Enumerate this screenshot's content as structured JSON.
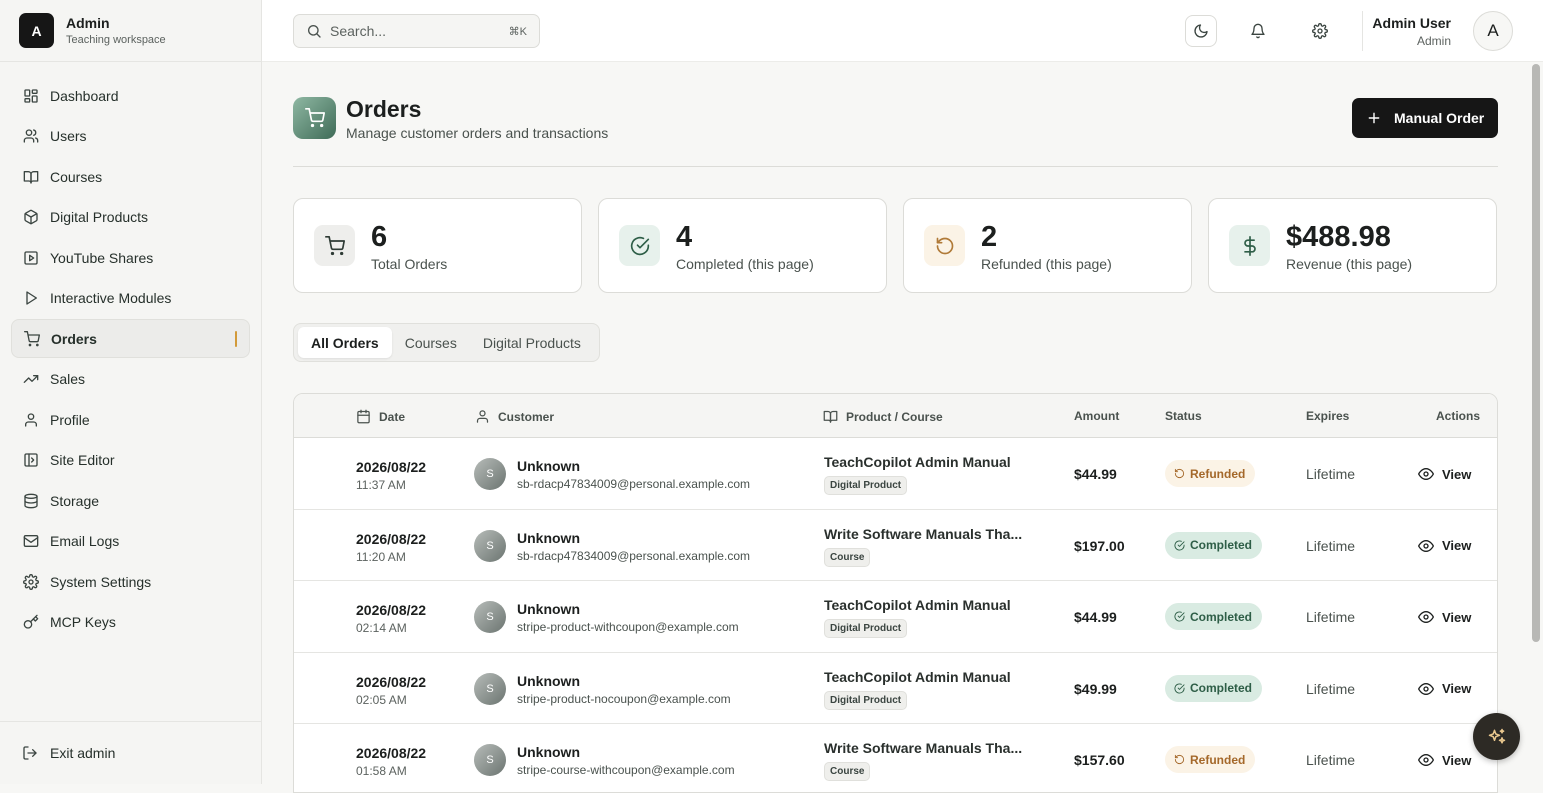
{
  "brand": {
    "logo_letter": "A",
    "name": "Admin",
    "subtitle": "Teaching workspace"
  },
  "sidebar": {
    "items": [
      {
        "label": "Dashboard",
        "icon": "dashboard-icon"
      },
      {
        "label": "Users",
        "icon": "users-icon"
      },
      {
        "label": "Courses",
        "icon": "book-icon"
      },
      {
        "label": "Digital Products",
        "icon": "package-icon"
      },
      {
        "label": "YouTube Shares",
        "icon": "video-icon"
      },
      {
        "label": "Interactive Modules",
        "icon": "play-icon"
      },
      {
        "label": "Orders",
        "icon": "cart-icon",
        "active": true
      },
      {
        "label": "Sales",
        "icon": "trending-up-icon"
      },
      {
        "label": "Profile",
        "icon": "user-icon"
      },
      {
        "label": "Site Editor",
        "icon": "layout-icon"
      },
      {
        "label": "Storage",
        "icon": "database-icon"
      },
      {
        "label": "Email Logs",
        "icon": "mail-icon"
      },
      {
        "label": "System Settings",
        "icon": "gear-icon"
      },
      {
        "label": "MCP Keys",
        "icon": "key-icon"
      }
    ],
    "footer_label": "Exit admin"
  },
  "topbar": {
    "search_placeholder": "Search...",
    "search_shortcut": "⌘K",
    "user_name": "Admin User",
    "user_role": "Admin",
    "avatar_letter": "A"
  },
  "page": {
    "title": "Orders",
    "subtitle": "Manage customer orders and transactions",
    "primary_button": "Manual Order"
  },
  "stats": [
    {
      "value": "6",
      "label": "Total Orders",
      "icon": "cart-icon",
      "tint": "#eeeeec",
      "color": "#2e3b35"
    },
    {
      "value": "4",
      "label": "Completed (this page)",
      "icon": "check-circle-icon",
      "tint": "#e7f1ec",
      "color": "#2e5e47"
    },
    {
      "value": "2",
      "label": "Refunded (this page)",
      "icon": "refresh-icon",
      "tint": "#fbf3e6",
      "color": "#b07a38"
    },
    {
      "value": "$488.98",
      "label": "Revenue (this page)",
      "icon": "dollar-icon",
      "tint": "#e7f1ec",
      "color": "#2e5e47"
    }
  ],
  "tabs": [
    {
      "label": "All Orders",
      "active": true
    },
    {
      "label": "Courses"
    },
    {
      "label": "Digital Products"
    }
  ],
  "table": {
    "headers": {
      "date": "Date",
      "customer": "Customer",
      "product": "Product / Course",
      "amount": "Amount",
      "status": "Status",
      "expires": "Expires",
      "actions": "Actions"
    },
    "rows": [
      {
        "date": "2026/08/22",
        "time": "11:37 AM",
        "avatar": "S",
        "name": "Unknown",
        "email": "sb-rdacp47834009@personal.example.com",
        "product": "TeachCopilot Admin Manual",
        "type": "Digital Product",
        "amount": "$44.99",
        "status": "Refunded",
        "expires": "Lifetime",
        "action": "View"
      },
      {
        "date": "2026/08/22",
        "time": "11:20 AM",
        "avatar": "S",
        "name": "Unknown",
        "email": "sb-rdacp47834009@personal.example.com",
        "product": "Write Software Manuals Tha...",
        "type": "Course",
        "amount": "$197.00",
        "status": "Completed",
        "expires": "Lifetime",
        "action": "View"
      },
      {
        "date": "2026/08/22",
        "time": "02:14 AM",
        "avatar": "S",
        "name": "Unknown",
        "email": "stripe-product-withcoupon@example.com",
        "product": "TeachCopilot Admin Manual",
        "type": "Digital Product",
        "amount": "$44.99",
        "status": "Completed",
        "expires": "Lifetime",
        "action": "View"
      },
      {
        "date": "2026/08/22",
        "time": "02:05 AM",
        "avatar": "S",
        "name": "Unknown",
        "email": "stripe-product-nocoupon@example.com",
        "product": "TeachCopilot Admin Manual",
        "type": "Digital Product",
        "amount": "$49.99",
        "status": "Completed",
        "expires": "Lifetime",
        "action": "View"
      },
      {
        "date": "2026/08/22",
        "time": "01:58 AM",
        "avatar": "S",
        "name": "Unknown",
        "email": "stripe-course-withcoupon@example.com",
        "product": "Write Software Manuals Tha...",
        "type": "Course",
        "amount": "$157.60",
        "status": "Refunded",
        "expires": "Lifetime",
        "action": "View"
      }
    ]
  }
}
